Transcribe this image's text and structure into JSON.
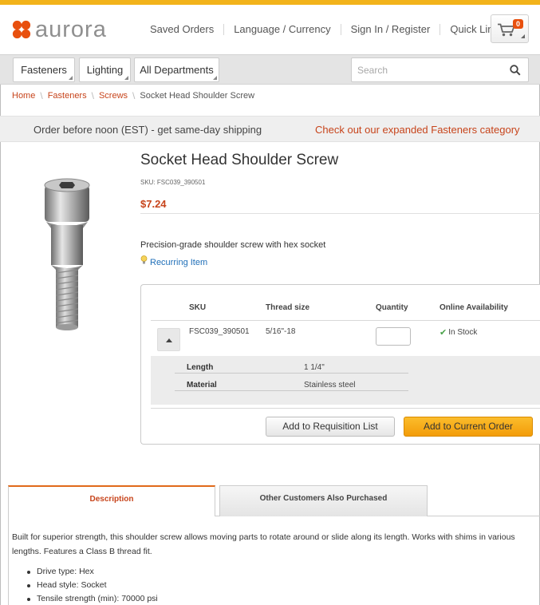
{
  "brand": {
    "name": "aurora",
    "logo_color": "#e8500e"
  },
  "top_nav": {
    "saved_orders": "Saved Orders",
    "language_currency": "Language / Currency",
    "sign_in": "Sign In / Register",
    "quick_links": "Quick Links"
  },
  "cart": {
    "count": "0",
    "icon": "cart-icon"
  },
  "departments": [
    "Fasteners",
    "Lighting",
    "All Departments"
  ],
  "search": {
    "placeholder": "Search",
    "value": ""
  },
  "breadcrumb": {
    "items": [
      "Home",
      "Fasteners",
      "Screws"
    ],
    "current": "Socket Head Shoulder Screw"
  },
  "promo": {
    "left": "Order before noon (EST) - get same-day shipping",
    "right": "Check out our expanded Fasteners category"
  },
  "product": {
    "title": "Socket Head Shoulder Screw",
    "sku_line": "SKU: FSC039_390501",
    "price": "$7.24",
    "short_description": "Precision-grade shoulder screw with hex socket",
    "recurring": "Recurring Item"
  },
  "sku_table": {
    "headers": {
      "sku": "SKU",
      "thread": "Thread size",
      "quantity": "Quantity",
      "availability": "Online Availability"
    },
    "row": {
      "sku": "FSC039_390501",
      "thread": "5/16\"-18",
      "quantity": "",
      "availability": "In Stock"
    },
    "attributes": [
      {
        "name": "Length",
        "value": "1 1/4\""
      },
      {
        "name": "Material",
        "value": "Stainless steel"
      }
    ]
  },
  "buttons": {
    "requisition": "Add to Requisition List",
    "order": "Add to Current Order"
  },
  "tabs": {
    "description": "Description",
    "other": "Other Customers Also Purchased"
  },
  "description": {
    "text": "Built for superior strength, this shoulder screw allows moving parts to rotate around or slide along its length. Works with shims in various lengths. Features a Class B thread fit.",
    "bullets": [
      "Drive type: Hex",
      "Head style: Socket",
      "Tensile strength (min): 70000 psi"
    ]
  },
  "colors": {
    "accent": "#c7441b",
    "top_bar": "#f2b31b",
    "order_button": "#f7a81b",
    "link": "#1f6fb8"
  }
}
